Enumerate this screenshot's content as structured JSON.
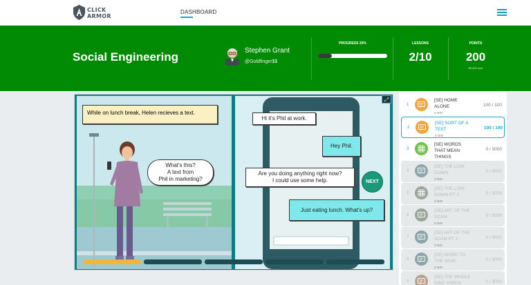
{
  "brand": {
    "line1": "CLICK",
    "line2": "ARMOR"
  },
  "nav": {
    "dashboard": "DASHBOARD"
  },
  "course": {
    "title": "Social Engineering"
  },
  "user": {
    "name": "Stephen Grant",
    "handle": "@Goldfinger$$"
  },
  "stats": {
    "progress_label": "PROGRESS 20%",
    "progress_fraction": 0.2,
    "lessons_label": "LESSONS",
    "lessons_value": "2/10",
    "points_label": "POINTS",
    "points_value": "200",
    "points_sub": "80,000 max"
  },
  "comic": {
    "caption": "While on lunch break, Helen recieves a text.",
    "thought_1": "What's this?",
    "thought_2": "A text from",
    "thought_3": "Phil in marketing?",
    "msg_1": "Hi it's Phil at work.",
    "msg_2": "Hey Phil.",
    "msg_3a": "Are you doing anything right now?",
    "msg_3b": "I could use some help.",
    "msg_4": "Just eating lunch. What's up?",
    "next_label": "NEXT",
    "segments_total": 5,
    "segments_done": 1
  },
  "lessons": [
    {
      "num": "1",
      "title_1": "[SE] HOME",
      "title_2": "ALONE",
      "minutes": "5 MIN",
      "score": "100 / 100",
      "state": "done",
      "icon": "chat-icon",
      "color": "#f2a33a"
    },
    {
      "num": "2",
      "title_1": "[SE] SORT OF A",
      "title_2": "TEST",
      "minutes": "5 MIN",
      "score": "100 / 100",
      "state": "current",
      "icon": "chat-icon",
      "color": "#f2a33a"
    },
    {
      "num": "3",
      "title_1": "[SE] WORDS",
      "title_2": "THAT MEAN",
      "title_3": "THINGS",
      "minutes": "",
      "score": "0 / 5000",
      "state": "open",
      "icon": "grid-icon",
      "color": "#6cc04a"
    },
    {
      "num": "4",
      "title_1": "[SE] THE LOW",
      "title_2": "DOWN",
      "minutes": "3 MIN",
      "score": "0 / 5000",
      "state": "locked",
      "icon": "chat-icon",
      "color": "#6f8f95"
    },
    {
      "num": "5",
      "title_1": "[SE] THE LOW",
      "title_2": "DOWN PT 2",
      "minutes": "3 MIN",
      "score": "0 / 5000",
      "state": "locked",
      "icon": "grid-icon",
      "color": "#7f9180"
    },
    {
      "num": "6",
      "title_1": "[SE] ART OF THE",
      "title_2": "SCAM",
      "minutes": "8 MIN",
      "score": "0 / 5000",
      "state": "locked",
      "icon": "chat-icon",
      "color": "#7f9180"
    },
    {
      "num": "7",
      "title_1": "[SE] ART OF THE",
      "title_2": "SCAM PT 2",
      "minutes": "3 MIN",
      "score": "0 / 5000",
      "state": "locked",
      "icon": "chat-icon",
      "color": "#6f8f95"
    },
    {
      "num": "8",
      "title_1": "[SE] WORD TO",
      "title_2": "THE WISE",
      "minutes": "5 MIN",
      "score": "0 / 5000",
      "state": "locked",
      "icon": "chat-icon",
      "color": "#6f8f95"
    },
    {
      "num": "9",
      "title_1": "[SE] THE WHOLE",
      "title_2": "NINE YARDS",
      "minutes": "",
      "score": "0 / 5000",
      "state": "locked",
      "icon": "chat-icon",
      "color": "#b08a70"
    }
  ]
}
